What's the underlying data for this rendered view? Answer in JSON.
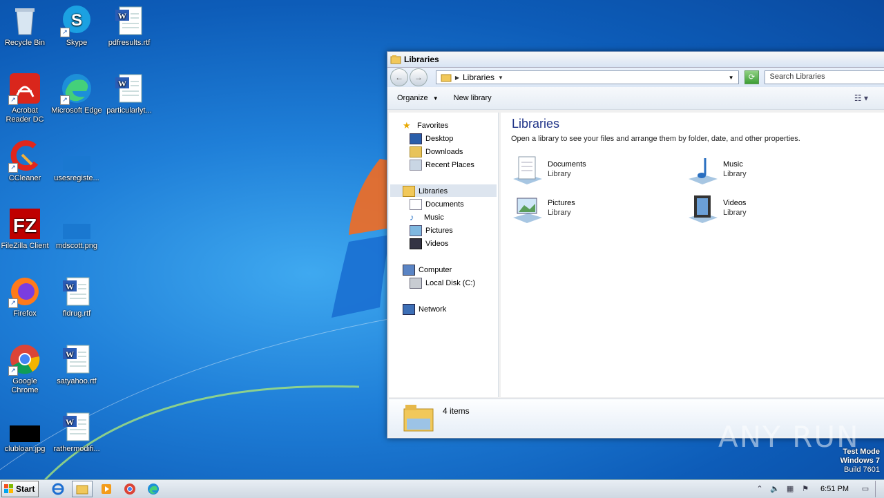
{
  "desktop": {
    "icons": [
      {
        "label": "Recycle Bin"
      },
      {
        "label": "Skype"
      },
      {
        "label": "pdfresults.rtf"
      },
      {
        "label": "Acrobat Reader DC"
      },
      {
        "label": "Microsoft Edge"
      },
      {
        "label": "particularlyt..."
      },
      {
        "label": "CCleaner"
      },
      {
        "label": "usesregiste..."
      },
      {
        "label": "FileZilla Client"
      },
      {
        "label": "mdscott.png"
      },
      {
        "label": "Firefox"
      },
      {
        "label": "fldrug.rtf"
      },
      {
        "label": "Google Chrome"
      },
      {
        "label": "satyahoo.rtf"
      },
      {
        "label": "clubloan.jpg"
      },
      {
        "label": "rathermodifi..."
      }
    ]
  },
  "explorer": {
    "title": "Libraries",
    "address": {
      "crumb": "Libraries"
    },
    "search_placeholder": "Search Libraries",
    "toolbar": {
      "organize": "Organize",
      "new_library": "New library"
    },
    "nav": {
      "favorites": "Favorites",
      "desktop": "Desktop",
      "downloads": "Downloads",
      "recent": "Recent Places",
      "libraries": "Libraries",
      "documents": "Documents",
      "music": "Music",
      "pictures": "Pictures",
      "videos": "Videos",
      "computer": "Computer",
      "local_disk": "Local Disk (C:)",
      "network": "Network"
    },
    "content": {
      "heading": "Libraries",
      "subtitle": "Open a library to see your files and arrange them by folder, date, and other properties.",
      "libraries": [
        {
          "name": "Documents",
          "type": "Library"
        },
        {
          "name": "Music",
          "type": "Library"
        },
        {
          "name": "Pictures",
          "type": "Library"
        },
        {
          "name": "Videos",
          "type": "Library"
        }
      ]
    },
    "details": {
      "count": "4 items"
    }
  },
  "watermark": "ANY RUN",
  "test_mode": {
    "line1": "Test Mode",
    "line2": "Windows 7",
    "line3": "Build 7601"
  },
  "taskbar": {
    "start": "Start",
    "clock": "6:51 PM"
  },
  "colors": {
    "accent": "#1e3287",
    "desktop": "#1f7fd8"
  }
}
